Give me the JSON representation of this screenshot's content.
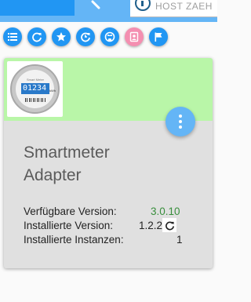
{
  "header": {
    "host_label": "HOST ZAEH"
  },
  "toolbar": {
    "buttons": [
      {
        "icon": "list-icon"
      },
      {
        "icon": "refresh-icon"
      },
      {
        "icon": "star-icon"
      },
      {
        "icon": "update-icon"
      },
      {
        "icon": "github-icon"
      },
      {
        "icon": "contact-icon"
      },
      {
        "icon": "flag-icon"
      }
    ]
  },
  "card": {
    "title_line1": "Smartmeter",
    "title_line2": "Adapter",
    "image": {
      "brand": "Smart Meter",
      "display": "01234",
      "unit": "kWh"
    },
    "available_label": "Verfügbare Version:",
    "available_value": "3.0.10",
    "installed_label": "Installierte Version:",
    "installed_value": "1.2.2",
    "instances_label": "Installierte Instanzen:",
    "instances_value": "1"
  },
  "colors": {
    "primary": "#2196f3",
    "header_green": "#b9f6a8",
    "version_green": "#388e3c",
    "fab": "#64b5f6"
  }
}
